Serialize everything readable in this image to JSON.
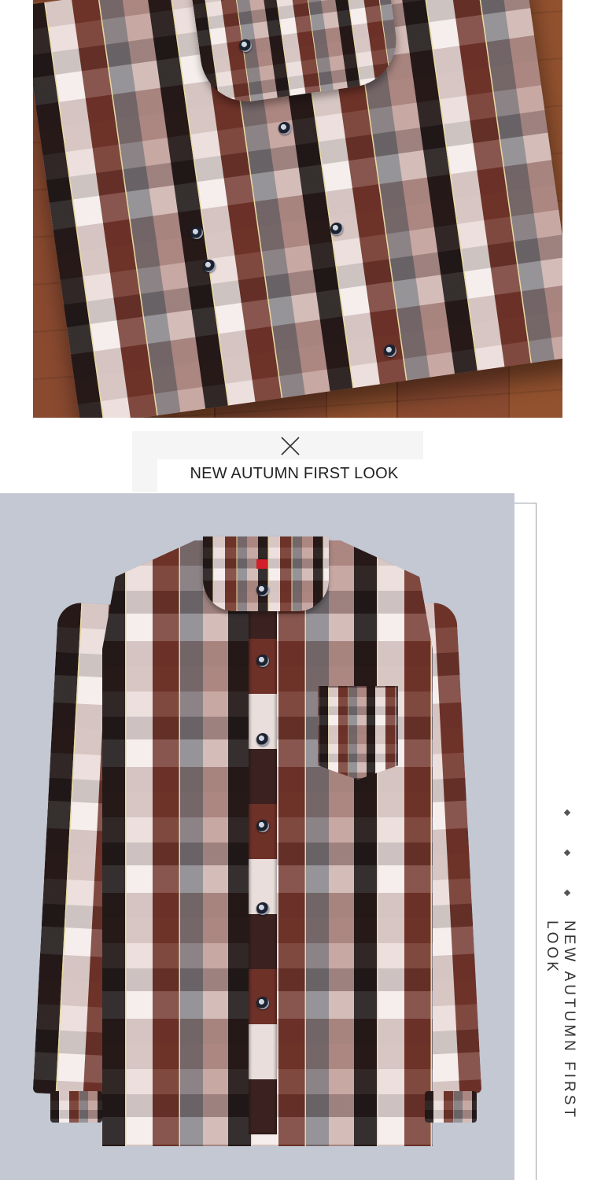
{
  "banner": {
    "text": "NEW AUTUMN FIRST LOOK",
    "icon": "x-mark-icon"
  },
  "side_caption": {
    "text": "NEW AUTUMN FIRST LOOK",
    "icon": "diamond-dot-icon"
  },
  "images": {
    "top": "folded plaid shirt on wooden table",
    "bottom": "plaid long-sleeve shirt on grey background"
  },
  "colors": {
    "banner_back": "#f5f5f5",
    "bottom_background": "#c3c8d3",
    "text": "#222222",
    "plaid_brown": "#6e3128",
    "plaid_black": "#1c1616",
    "plaid_white": "#f1e8e6",
    "label_red": "#d21f2a"
  }
}
